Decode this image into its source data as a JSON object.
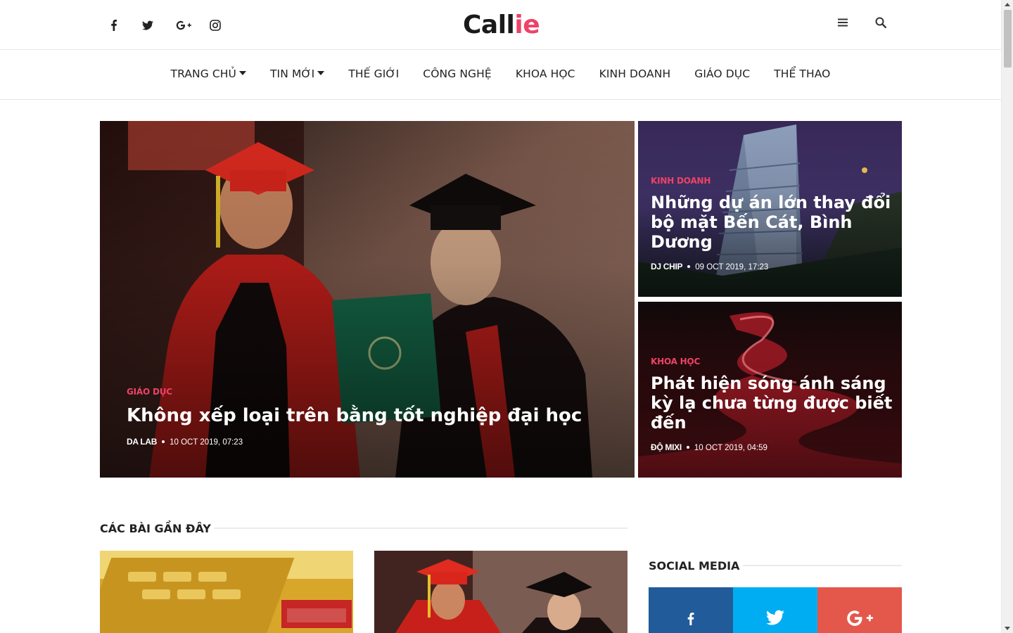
{
  "logo": {
    "text_main": "Call",
    "text_accent": "ie"
  },
  "header": {
    "social_icons": [
      "facebook-icon",
      "twitter-icon",
      "google-plus-icon",
      "instagram-icon"
    ],
    "actions": [
      "menu-icon",
      "search-icon"
    ]
  },
  "nav": {
    "items": [
      {
        "label": "TRANG CHỦ",
        "dropdown": true
      },
      {
        "label": "TIN MỚI",
        "dropdown": true
      },
      {
        "label": "THẾ GIỚI",
        "dropdown": false
      },
      {
        "label": "CÔNG NGHỆ",
        "dropdown": false
      },
      {
        "label": "KHOA HỌC",
        "dropdown": false
      },
      {
        "label": "KINH DOANH",
        "dropdown": false
      },
      {
        "label": "GIÁO DỤC",
        "dropdown": false
      },
      {
        "label": "THỂ THAO",
        "dropdown": false
      }
    ]
  },
  "hero": {
    "main": {
      "category": "GIÁO DỤC",
      "title": "Không xếp loại trên bằng tốt nghiệp đại học",
      "author": "DA LAB",
      "date": "10 OCT 2019, 07:23"
    },
    "side": [
      {
        "category": "KINH DOANH",
        "title": "Những dự án lớn thay đổi bộ mặt Bến Cát, Bình Dương",
        "author": "DJ CHIP",
        "date": "09 OCT 2019, 17:23"
      },
      {
        "category": "KHOA HỌC",
        "title": "Phát hiện sóng ánh sáng kỳ lạ chưa từng được biết đến",
        "author": "ĐỘ MIXI",
        "date": "10 OCT 2019, 04:59"
      }
    ]
  },
  "recent": {
    "heading": "CÁC BÀI GẦN ĐÂY"
  },
  "social_media": {
    "heading": "SOCIAL MEDIA",
    "buttons": [
      {
        "network": "facebook-icon",
        "color": "#225b99"
      },
      {
        "network": "twitter-icon",
        "color": "#00adf2"
      },
      {
        "network": "google-plus-icon",
        "color": "#e4584b"
      }
    ]
  },
  "colors": {
    "accent": "#ee4266",
    "text": "#222222",
    "divider": "#ebebeb"
  }
}
